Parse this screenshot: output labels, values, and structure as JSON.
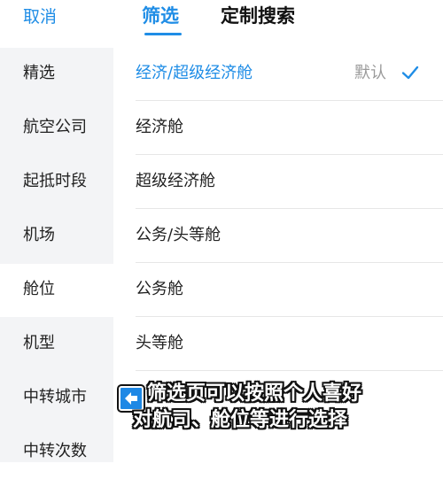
{
  "header": {
    "cancel_label": "取消",
    "tabs": [
      {
        "label": "筛选",
        "active": true
      },
      {
        "label": "定制搜索",
        "active": false
      }
    ]
  },
  "sidebar": {
    "items": [
      {
        "label": "精选"
      },
      {
        "label": "航空公司"
      },
      {
        "label": "起抵时段"
      },
      {
        "label": "机场"
      },
      {
        "label": "舱位",
        "active": true
      },
      {
        "label": "机型"
      },
      {
        "label": "中转城市"
      },
      {
        "label": "中转次数"
      }
    ]
  },
  "options": {
    "default_label": "默认",
    "items": [
      {
        "label": "经济/超级经济舱",
        "selected": true
      },
      {
        "label": "经济舱"
      },
      {
        "label": "超级经济舱"
      },
      {
        "label": "公务/头等舱"
      },
      {
        "label": "公务舱"
      },
      {
        "label": "头等舱"
      }
    ]
  },
  "caption": {
    "line1": "筛选页可以按照个人喜好",
    "line2": "对航司、舱位等进行选择",
    "icon": "arrow-left-icon"
  },
  "colors": {
    "accent": "#1f8de6",
    "sidebar_bg": "#f3f4f6"
  }
}
